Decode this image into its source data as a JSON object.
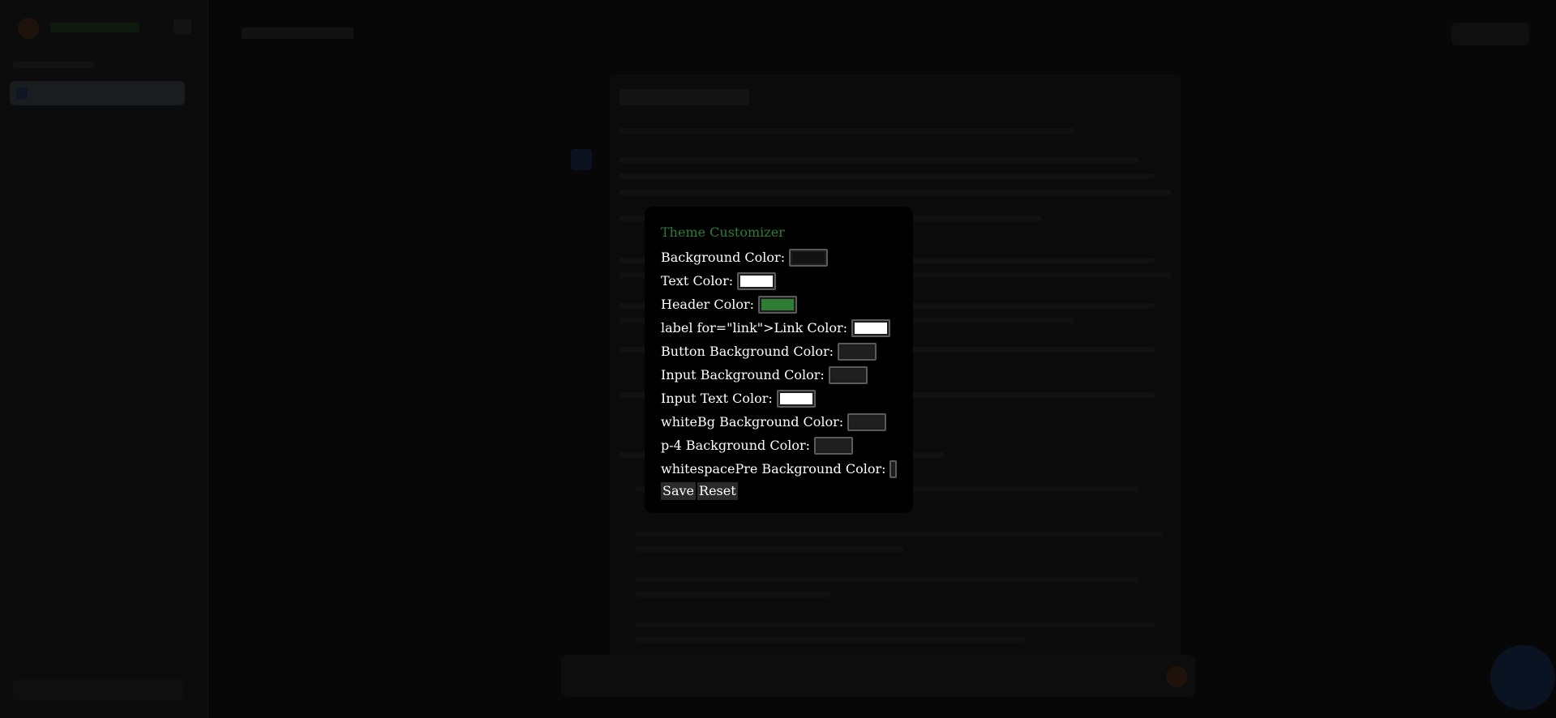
{
  "modal": {
    "title": "Theme Customizer",
    "title_color": "#2e7d32",
    "fields": [
      {
        "label": "Background Color:",
        "color": "#121212"
      },
      {
        "label": "Text Color:",
        "color": "#ffffff"
      },
      {
        "label": "Header Color:",
        "color": "#2e7d32"
      },
      {
        "label": "label for=\"link\">Link Color:",
        "color": "#ffffff"
      },
      {
        "label": "Button Background Color:",
        "color": "#1f1f1f"
      },
      {
        "label": "Input Background Color:",
        "color": "#1f1f1f"
      },
      {
        "label": "Input Text Color:",
        "color": "#ffffff"
      },
      {
        "label": "whiteBg Background Color:",
        "color": "#1f1f1f"
      },
      {
        "label": "p-4 Background Color:",
        "color": "#1f1f1f"
      },
      {
        "label": "whitespacePre Background Color:",
        "color": "#1f1f1f"
      }
    ],
    "save_label": "Save",
    "reset_label": "Reset"
  }
}
